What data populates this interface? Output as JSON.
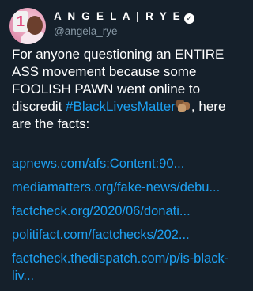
{
  "author": {
    "display_name": "A N G E L A | R Y E",
    "handle": "@angela_rye",
    "verified_icon": "verified-badge-icon",
    "avatar_badge": "1"
  },
  "tweet": {
    "text_part1": "For anyone questioning an ENTIRE ASS movement because some FOOLISH PAWN went online to discredit ",
    "hashtag": "#BlackLivesMatter",
    "emoji_icon": "raised-fists-emoji",
    "text_part2": ", here are the facts:"
  },
  "links": [
    "apnews.com/afs:Content:90...",
    "mediamatters.org/fake-news/debu...",
    "factcheck.org/2020/06/donati...",
    "politifact.com/factchecks/202...",
    "factcheck.thedispatch.com/p/is-black-liv..."
  ],
  "colors": {
    "background": "#15202b",
    "link": "#1da1f2",
    "secondary_text": "#8899a6"
  }
}
